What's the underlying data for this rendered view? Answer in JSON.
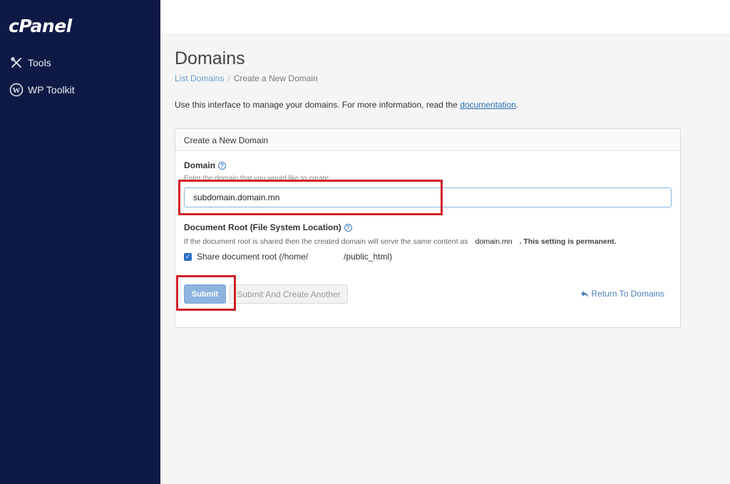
{
  "sidebar": {
    "logo": "cPanel",
    "items": [
      {
        "label": "Tools",
        "icon": "tools-icon"
      },
      {
        "label": "WP Toolkit",
        "icon": "wordpress-icon"
      }
    ]
  },
  "page": {
    "title": "Domains",
    "breadcrumb": {
      "parent": "List Domains",
      "separator": "/",
      "current": "Create a New Domain"
    },
    "intro_text": "Use this interface to manage your domains. For more information, read the ",
    "intro_link": "documentation",
    "intro_end": "."
  },
  "panel": {
    "heading": "Create a New Domain",
    "domain_label": "Domain",
    "domain_hint": "Enter the domain that you would like to create:",
    "domain_value": "subdomain.domain.mn",
    "docroot_label": "Document Root (File System Location)",
    "docroot_hint": "If the document root is shared then the created domain will serve the same content as",
    "docroot_domain": "domain.mn",
    "docroot_permanent": ". This setting is permanent.",
    "share_label_start": "Share document root (/home/",
    "share_label_end": "/public_html)",
    "submit_label": "Submit",
    "submit_another_label": "Submit And Create Another",
    "return_label": "Return To Domains"
  },
  "colors": {
    "sidebar_bg": "#0e1a45",
    "primary": "#8db4df",
    "link": "#4a7fbf",
    "highlight": "#d1202a"
  }
}
